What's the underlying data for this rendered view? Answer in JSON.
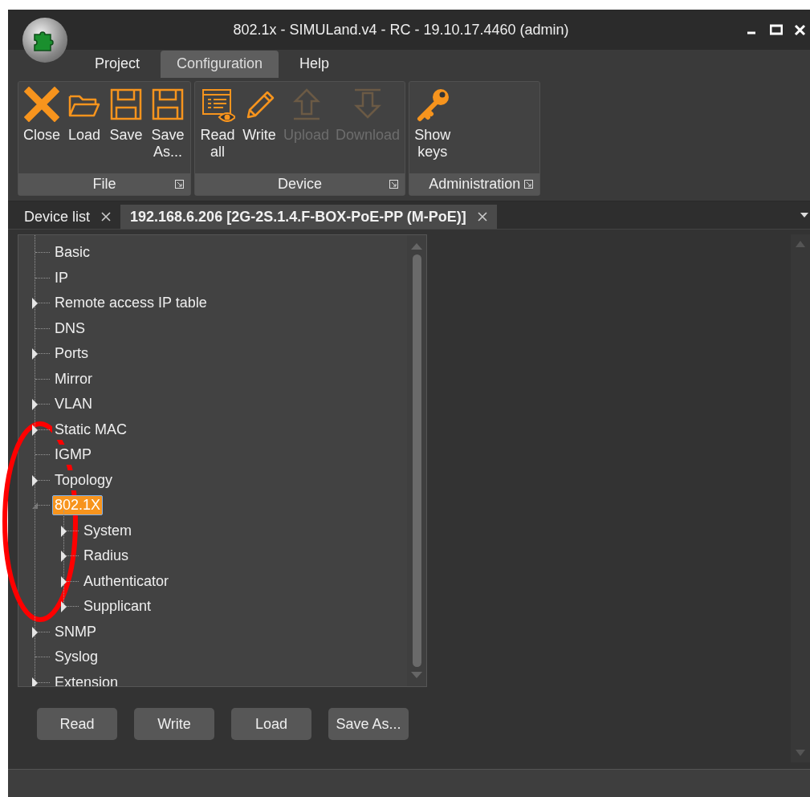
{
  "window": {
    "title": "802.1x - SIMULand.v4 - RC - 19.10.17.4460 (admin)"
  },
  "menu_tabs": [
    {
      "label": "Project",
      "selected": false
    },
    {
      "label": "Configuration",
      "selected": true
    },
    {
      "label": "Help",
      "selected": false
    }
  ],
  "ribbon_groups": [
    {
      "label": "File",
      "buttons": [
        {
          "label": "Close",
          "kind": "close",
          "disabled": false
        },
        {
          "label": "Load",
          "kind": "folder",
          "disabled": false
        },
        {
          "label": "Save",
          "kind": "save",
          "disabled": false
        },
        {
          "label": "Save As...",
          "kind": "save",
          "disabled": false
        }
      ]
    },
    {
      "label": "Device",
      "buttons": [
        {
          "label": "Read all",
          "kind": "read",
          "disabled": false
        },
        {
          "label": "Write",
          "kind": "pencil",
          "disabled": false
        },
        {
          "label": "Upload",
          "kind": "upload",
          "disabled": true
        },
        {
          "label": "Download",
          "kind": "download",
          "disabled": true
        }
      ]
    },
    {
      "label": "Administration",
      "buttons": [
        {
          "label": "Show keys",
          "kind": "key",
          "disabled": false
        }
      ]
    }
  ],
  "document_tabs": [
    {
      "label": "Device list",
      "selected": false
    },
    {
      "label": "192.168.6.206 [2G-2S.1.4.F-BOX-PoE-PP (M-PoE)]",
      "selected": true
    }
  ],
  "tree": [
    {
      "label": "Basic",
      "kind": "leaf",
      "selected": false
    },
    {
      "label": "IP",
      "kind": "leaf",
      "selected": false
    },
    {
      "label": "Remote access IP table",
      "kind": "collapsed",
      "selected": false
    },
    {
      "label": "DNS",
      "kind": "leaf",
      "selected": false
    },
    {
      "label": "Ports",
      "kind": "collapsed",
      "selected": false
    },
    {
      "label": "Mirror",
      "kind": "leaf",
      "selected": false
    },
    {
      "label": "VLAN",
      "kind": "collapsed",
      "selected": false
    },
    {
      "label": "Static MAC",
      "kind": "collapsed",
      "selected": false
    },
    {
      "label": "IGMP",
      "kind": "leaf",
      "selected": false
    },
    {
      "label": "Topology",
      "kind": "collapsed",
      "selected": false
    },
    {
      "label": "802.1X",
      "kind": "expanded",
      "selected": true,
      "children": [
        {
          "label": "System",
          "kind": "collapsed",
          "selected": false
        },
        {
          "label": "Radius",
          "kind": "collapsed",
          "selected": false
        },
        {
          "label": "Authenticator",
          "kind": "collapsed",
          "selected": false
        },
        {
          "label": "Supplicant",
          "kind": "collapsed",
          "selected": false
        }
      ]
    },
    {
      "label": "SNMP",
      "kind": "collapsed",
      "selected": false
    },
    {
      "label": "Syslog",
      "kind": "leaf",
      "selected": false
    },
    {
      "label": "Extension",
      "kind": "collapsed",
      "selected": false
    }
  ],
  "buttons": [
    "Read",
    "Write",
    "Load",
    "Save As..."
  ],
  "annotation": {
    "kind": "ellipse",
    "color": "#ff0000"
  }
}
